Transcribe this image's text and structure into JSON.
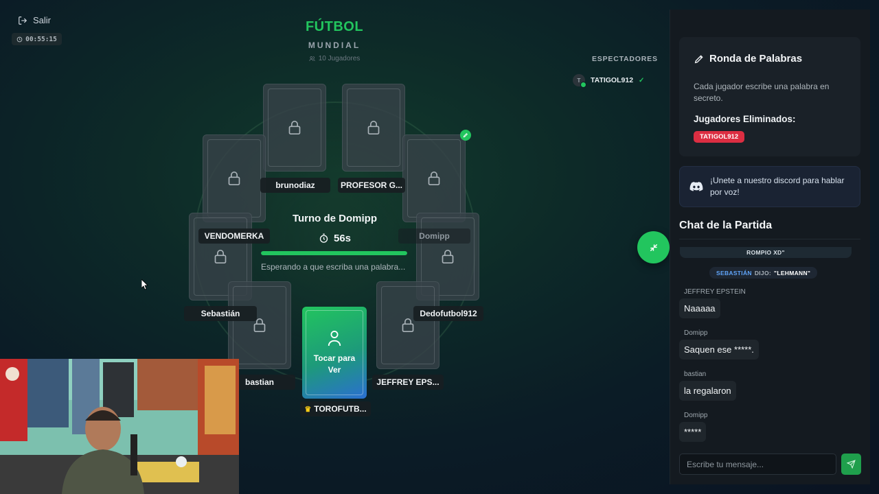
{
  "topbar": {
    "exit_label": "Salir",
    "timer": "00:55:15"
  },
  "header": {
    "title": "FÚTBOL",
    "subtitle": "MUNDIAL",
    "players_count": "10 Jugadores"
  },
  "spectators": {
    "title": "ESPECTADORES",
    "list": [
      {
        "initial": "T",
        "name": "TATIGOL912"
      }
    ]
  },
  "table": {
    "players": [
      {
        "name": "brunodiaz",
        "dim": false
      },
      {
        "name": "PROFESOR G...",
        "dim": false
      },
      {
        "name": "VENDOMERKA",
        "dim": false
      },
      {
        "name": "Domipp",
        "dim": true
      },
      {
        "name": "Sebastián",
        "dim": false
      },
      {
        "name": "Dedofutbol912",
        "dim": false
      },
      {
        "name": "bastian",
        "dim": false
      },
      {
        "name": "JEFFREY EPS...",
        "dim": false
      },
      {
        "name": "TOROFUTB...",
        "dim": false
      }
    ],
    "my_card_label": "Tocar para Ver",
    "crown_icon": "crown-icon"
  },
  "turn": {
    "title": "Turno de Domipp",
    "time": "56s",
    "progress": 1.0,
    "waiting": "Esperando a que escriba una palabra..."
  },
  "round": {
    "title": "Ronda de Palabras",
    "description": "Cada jugador escribe una palabra en secreto.",
    "eliminated_title": "Jugadores Eliminados:",
    "eliminated": [
      "TATIGOL912"
    ]
  },
  "discord": {
    "text": "¡Unete a nuestro discord para hablar por voz!"
  },
  "chat": {
    "title": "Chat de la Partida",
    "system_top": "ROMPIO XD\"",
    "system_msg": {
      "name": "SEBASTIÁN",
      "said": "DIJO:",
      "word": "\"LEHMANN\""
    },
    "messages": [
      {
        "author": "JEFFREY EPSTEIN",
        "text": "Naaaaa"
      },
      {
        "author": "Domipp",
        "text": "Saquen ese *****."
      },
      {
        "author": "bastian",
        "text": "la regalaron"
      },
      {
        "author": "Domipp",
        "text": "*****"
      }
    ],
    "input_placeholder": "Escribe tu mensaje..."
  },
  "colors": {
    "accent": "#22c55e",
    "danger": "#dc2e42",
    "panel": "#141a20",
    "link": "#60a5fa"
  }
}
